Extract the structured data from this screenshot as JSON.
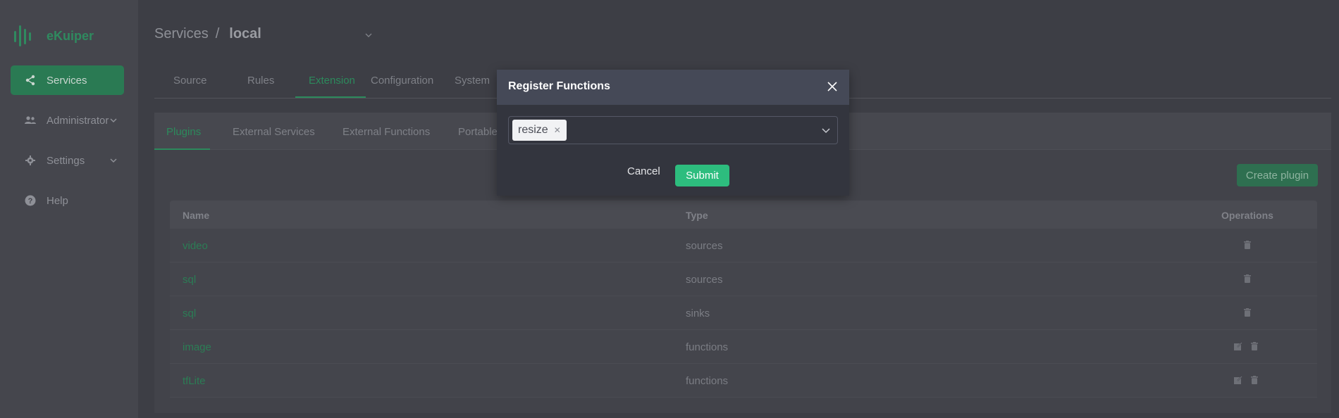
{
  "app": {
    "name": "eKuiper",
    "brand_color": "#2f8a5f"
  },
  "sidebar": {
    "items": [
      {
        "label": "Services",
        "icon": "share-icon",
        "active": true
      },
      {
        "label": "Administrator",
        "icon": "users-icon",
        "expandable": true
      },
      {
        "label": "Settings",
        "icon": "gear-icon",
        "expandable": true
      },
      {
        "label": "Help",
        "icon": "help-icon"
      }
    ]
  },
  "breadcrumb": {
    "root": "Services",
    "separator": "/",
    "current": "local"
  },
  "tabs": [
    "Source",
    "Rules",
    "Extension",
    "Configuration",
    "System"
  ],
  "active_tab": "Extension",
  "subtabs": [
    "Plugins",
    "External Services",
    "External Functions",
    "Portable"
  ],
  "active_subtab": "Plugins",
  "create_button": "Create plugin",
  "table": {
    "headers": {
      "name": "Name",
      "type": "Type",
      "operations": "Operations"
    },
    "rows": [
      {
        "name": "video",
        "type": "sources",
        "ops": [
          "delete-icon"
        ]
      },
      {
        "name": "sql",
        "type": "sources",
        "ops": [
          "delete-icon"
        ]
      },
      {
        "name": "sql",
        "type": "sinks",
        "ops": [
          "delete-icon"
        ]
      },
      {
        "name": "image",
        "type": "functions",
        "ops": [
          "edit-icon",
          "delete-icon"
        ]
      },
      {
        "name": "tfLite",
        "type": "functions",
        "ops": [
          "edit-icon",
          "delete-icon"
        ]
      }
    ]
  },
  "modal": {
    "title": "Register Functions",
    "selected_tags": [
      "resize"
    ],
    "cancel": "Cancel",
    "submit": "Submit",
    "submit_color": "#2dbd7e"
  }
}
